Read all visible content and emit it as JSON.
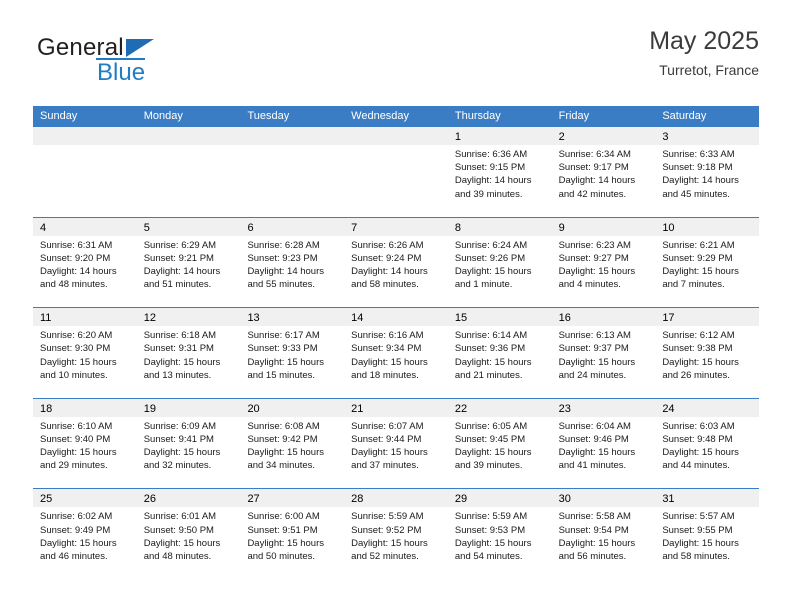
{
  "logo": {
    "word_one": "General",
    "word_two": "Blue",
    "triangle": "triangle-icon",
    "accent_color": "#1f7dc4"
  },
  "header": {
    "title": "May 2025",
    "subtitle": "Turretot, France"
  },
  "calendar": {
    "header_bg": "#3b7dc4",
    "daynum_bg": "#f0f0f0",
    "weekdays": [
      "Sunday",
      "Monday",
      "Tuesday",
      "Wednesday",
      "Thursday",
      "Friday",
      "Saturday"
    ],
    "weeks": [
      [
        {
          "day": "",
          "empty": true
        },
        {
          "day": "",
          "empty": true
        },
        {
          "day": "",
          "empty": true
        },
        {
          "day": "",
          "empty": true
        },
        {
          "day": "1",
          "sunrise": "Sunrise: 6:36 AM",
          "sunset": "Sunset: 9:15 PM",
          "daylight_line1": "Daylight: 14 hours",
          "daylight_line2": "and 39 minutes."
        },
        {
          "day": "2",
          "sunrise": "Sunrise: 6:34 AM",
          "sunset": "Sunset: 9:17 PM",
          "daylight_line1": "Daylight: 14 hours",
          "daylight_line2": "and 42 minutes."
        },
        {
          "day": "3",
          "sunrise": "Sunrise: 6:33 AM",
          "sunset": "Sunset: 9:18 PM",
          "daylight_line1": "Daylight: 14 hours",
          "daylight_line2": "and 45 minutes."
        }
      ],
      [
        {
          "day": "4",
          "sunrise": "Sunrise: 6:31 AM",
          "sunset": "Sunset: 9:20 PM",
          "daylight_line1": "Daylight: 14 hours",
          "daylight_line2": "and 48 minutes."
        },
        {
          "day": "5",
          "sunrise": "Sunrise: 6:29 AM",
          "sunset": "Sunset: 9:21 PM",
          "daylight_line1": "Daylight: 14 hours",
          "daylight_line2": "and 51 minutes."
        },
        {
          "day": "6",
          "sunrise": "Sunrise: 6:28 AM",
          "sunset": "Sunset: 9:23 PM",
          "daylight_line1": "Daylight: 14 hours",
          "daylight_line2": "and 55 minutes."
        },
        {
          "day": "7",
          "sunrise": "Sunrise: 6:26 AM",
          "sunset": "Sunset: 9:24 PM",
          "daylight_line1": "Daylight: 14 hours",
          "daylight_line2": "and 58 minutes."
        },
        {
          "day": "8",
          "sunrise": "Sunrise: 6:24 AM",
          "sunset": "Sunset: 9:26 PM",
          "daylight_line1": "Daylight: 15 hours",
          "daylight_line2": "and 1 minute."
        },
        {
          "day": "9",
          "sunrise": "Sunrise: 6:23 AM",
          "sunset": "Sunset: 9:27 PM",
          "daylight_line1": "Daylight: 15 hours",
          "daylight_line2": "and 4 minutes."
        },
        {
          "day": "10",
          "sunrise": "Sunrise: 6:21 AM",
          "sunset": "Sunset: 9:29 PM",
          "daylight_line1": "Daylight: 15 hours",
          "daylight_line2": "and 7 minutes."
        }
      ],
      [
        {
          "day": "11",
          "sunrise": "Sunrise: 6:20 AM",
          "sunset": "Sunset: 9:30 PM",
          "daylight_line1": "Daylight: 15 hours",
          "daylight_line2": "and 10 minutes."
        },
        {
          "day": "12",
          "sunrise": "Sunrise: 6:18 AM",
          "sunset": "Sunset: 9:31 PM",
          "daylight_line1": "Daylight: 15 hours",
          "daylight_line2": "and 13 minutes."
        },
        {
          "day": "13",
          "sunrise": "Sunrise: 6:17 AM",
          "sunset": "Sunset: 9:33 PM",
          "daylight_line1": "Daylight: 15 hours",
          "daylight_line2": "and 15 minutes."
        },
        {
          "day": "14",
          "sunrise": "Sunrise: 6:16 AM",
          "sunset": "Sunset: 9:34 PM",
          "daylight_line1": "Daylight: 15 hours",
          "daylight_line2": "and 18 minutes."
        },
        {
          "day": "15",
          "sunrise": "Sunrise: 6:14 AM",
          "sunset": "Sunset: 9:36 PM",
          "daylight_line1": "Daylight: 15 hours",
          "daylight_line2": "and 21 minutes."
        },
        {
          "day": "16",
          "sunrise": "Sunrise: 6:13 AM",
          "sunset": "Sunset: 9:37 PM",
          "daylight_line1": "Daylight: 15 hours",
          "daylight_line2": "and 24 minutes."
        },
        {
          "day": "17",
          "sunrise": "Sunrise: 6:12 AM",
          "sunset": "Sunset: 9:38 PM",
          "daylight_line1": "Daylight: 15 hours",
          "daylight_line2": "and 26 minutes."
        }
      ],
      [
        {
          "day": "18",
          "sunrise": "Sunrise: 6:10 AM",
          "sunset": "Sunset: 9:40 PM",
          "daylight_line1": "Daylight: 15 hours",
          "daylight_line2": "and 29 minutes."
        },
        {
          "day": "19",
          "sunrise": "Sunrise: 6:09 AM",
          "sunset": "Sunset: 9:41 PM",
          "daylight_line1": "Daylight: 15 hours",
          "daylight_line2": "and 32 minutes."
        },
        {
          "day": "20",
          "sunrise": "Sunrise: 6:08 AM",
          "sunset": "Sunset: 9:42 PM",
          "daylight_line1": "Daylight: 15 hours",
          "daylight_line2": "and 34 minutes."
        },
        {
          "day": "21",
          "sunrise": "Sunrise: 6:07 AM",
          "sunset": "Sunset: 9:44 PM",
          "daylight_line1": "Daylight: 15 hours",
          "daylight_line2": "and 37 minutes."
        },
        {
          "day": "22",
          "sunrise": "Sunrise: 6:05 AM",
          "sunset": "Sunset: 9:45 PM",
          "daylight_line1": "Daylight: 15 hours",
          "daylight_line2": "and 39 minutes."
        },
        {
          "day": "23",
          "sunrise": "Sunrise: 6:04 AM",
          "sunset": "Sunset: 9:46 PM",
          "daylight_line1": "Daylight: 15 hours",
          "daylight_line2": "and 41 minutes."
        },
        {
          "day": "24",
          "sunrise": "Sunrise: 6:03 AM",
          "sunset": "Sunset: 9:48 PM",
          "daylight_line1": "Daylight: 15 hours",
          "daylight_line2": "and 44 minutes."
        }
      ],
      [
        {
          "day": "25",
          "sunrise": "Sunrise: 6:02 AM",
          "sunset": "Sunset: 9:49 PM",
          "daylight_line1": "Daylight: 15 hours",
          "daylight_line2": "and 46 minutes."
        },
        {
          "day": "26",
          "sunrise": "Sunrise: 6:01 AM",
          "sunset": "Sunset: 9:50 PM",
          "daylight_line1": "Daylight: 15 hours",
          "daylight_line2": "and 48 minutes."
        },
        {
          "day": "27",
          "sunrise": "Sunrise: 6:00 AM",
          "sunset": "Sunset: 9:51 PM",
          "daylight_line1": "Daylight: 15 hours",
          "daylight_line2": "and 50 minutes."
        },
        {
          "day": "28",
          "sunrise": "Sunrise: 5:59 AM",
          "sunset": "Sunset: 9:52 PM",
          "daylight_line1": "Daylight: 15 hours",
          "daylight_line2": "and 52 minutes."
        },
        {
          "day": "29",
          "sunrise": "Sunrise: 5:59 AM",
          "sunset": "Sunset: 9:53 PM",
          "daylight_line1": "Daylight: 15 hours",
          "daylight_line2": "and 54 minutes."
        },
        {
          "day": "30",
          "sunrise": "Sunrise: 5:58 AM",
          "sunset": "Sunset: 9:54 PM",
          "daylight_line1": "Daylight: 15 hours",
          "daylight_line2": "and 56 minutes."
        },
        {
          "day": "31",
          "sunrise": "Sunrise: 5:57 AM",
          "sunset": "Sunset: 9:55 PM",
          "daylight_line1": "Daylight: 15 hours",
          "daylight_line2": "and 58 minutes."
        }
      ]
    ]
  }
}
